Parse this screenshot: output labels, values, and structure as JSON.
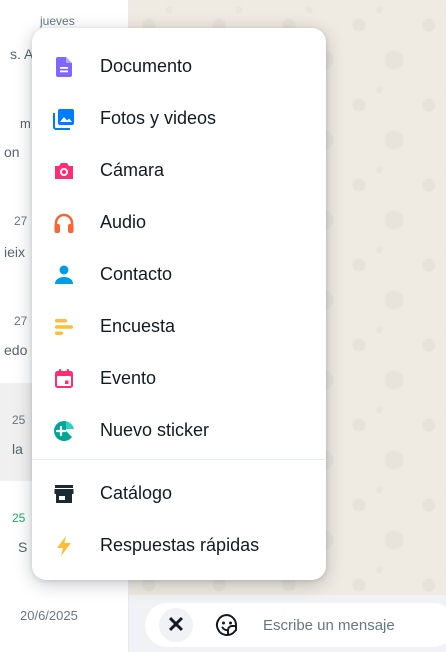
{
  "chat_list": {
    "rows": [
      {
        "time": "jueves",
        "snippet": "s. A"
      },
      {
        "time": "",
        "snippet": "m"
      },
      {
        "time": "",
        "snippet": "on"
      },
      {
        "time": "27",
        "snippet": "ieix"
      },
      {
        "time": "27",
        "snippet": "edo"
      },
      {
        "time": "25",
        "snippet": "la"
      },
      {
        "time": "25",
        "snippet": "S"
      }
    ],
    "date": "20/6/2025"
  },
  "attach_menu": {
    "items": [
      {
        "label": "Documento",
        "icon": "document-icon",
        "color": "#7f66ff"
      },
      {
        "label": "Fotos y videos",
        "icon": "photos-icon",
        "color": "#007bfc"
      },
      {
        "label": "Cámara",
        "icon": "camera-icon",
        "color": "#ff2e74"
      },
      {
        "label": "Audio",
        "icon": "headphones-icon",
        "color": "#fa6533"
      },
      {
        "label": "Contacto",
        "icon": "contact-icon",
        "color": "#009de2"
      },
      {
        "label": "Encuesta",
        "icon": "poll-icon",
        "color": "#ffbc38"
      },
      {
        "label": "Evento",
        "icon": "calendar-icon",
        "color": "#ff2e74"
      },
      {
        "label": "Nuevo sticker",
        "icon": "sticker-add-icon",
        "color": "#02a698"
      },
      {
        "label": "Catálogo",
        "icon": "store-icon",
        "color": "#1b2b33"
      },
      {
        "label": "Respuestas rápidas",
        "icon": "lightning-icon",
        "color": "#ffbc38"
      }
    ]
  },
  "composer": {
    "close_symbol": "✕",
    "placeholder": "Escribe un mensaje"
  }
}
